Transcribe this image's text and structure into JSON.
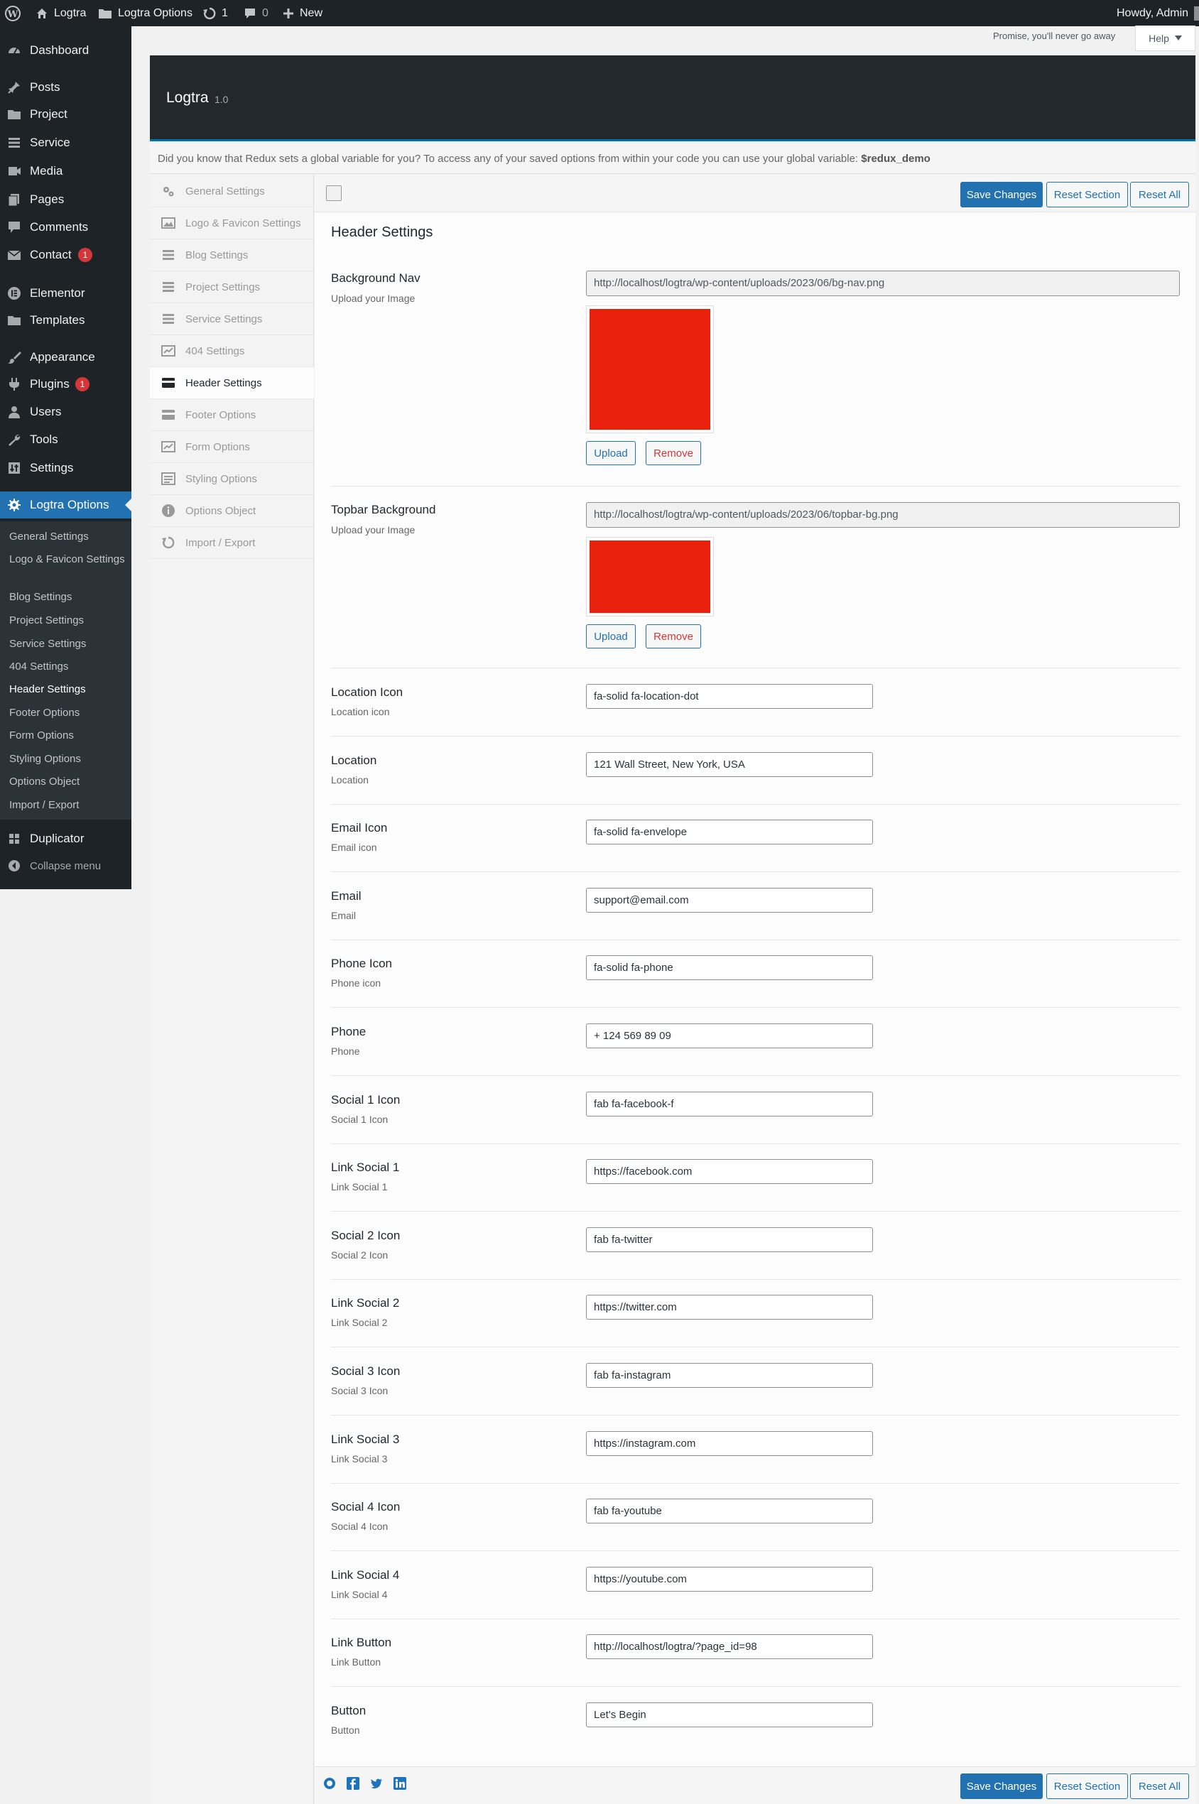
{
  "colors": {
    "admin_dark": "#1d2327",
    "accent": "#2271b1",
    "preview_red": "#e8200c",
    "badge_red": "#d63638"
  },
  "adminbar": {
    "site": "Logtra",
    "options": "Logtra Options",
    "updates": "1",
    "comments": "0",
    "new": "New",
    "howdy": "Howdy, Admin"
  },
  "sidebar": {
    "items": [
      {
        "label": "Dashboard",
        "icon": "dashboard-icon"
      },
      {
        "label": "Posts",
        "icon": "pin-icon"
      },
      {
        "label": "Project",
        "icon": "folder-icon"
      },
      {
        "label": "Service",
        "icon": "list-icon"
      },
      {
        "label": "Media",
        "icon": "media-icon"
      },
      {
        "label": "Pages",
        "icon": "pages-icon"
      },
      {
        "label": "Comments",
        "icon": "comment-icon"
      },
      {
        "label": "Contact",
        "icon": "mail-icon",
        "badge": "1"
      },
      {
        "label": "Elementor",
        "icon": "elementor-icon"
      },
      {
        "label": "Templates",
        "icon": "folder-icon"
      },
      {
        "label": "Appearance",
        "icon": "brush-icon"
      },
      {
        "label": "Plugins",
        "icon": "plug-icon",
        "badge": "1"
      },
      {
        "label": "Users",
        "icon": "user-icon"
      },
      {
        "label": "Tools",
        "icon": "wrench-icon"
      },
      {
        "label": "Settings",
        "icon": "settings-icon"
      },
      {
        "label": "Logtra Options",
        "icon": "gear-icon"
      },
      {
        "label": "Duplicator",
        "icon": "duplicator-icon"
      },
      {
        "label": "Collapse menu",
        "icon": "collapse-icon"
      }
    ],
    "submenu": [
      "General Settings",
      "Logo & Favicon Settings",
      "Blog Settings",
      "Project Settings",
      "Service Settings",
      "404 Settings",
      "Header Settings",
      "Footer Options",
      "Form Options",
      "Styling Options",
      "Options Object",
      "Import / Export"
    ]
  },
  "topright": {
    "promise": "Promise, you'll never go away",
    "help": "Help"
  },
  "redux": {
    "title": "Logtra",
    "version": "1.0",
    "notice": "Did you know that Redux sets a global variable for you? To access any of your saved options from within your code you can use your global variable:",
    "notice_var": "$redux_demo",
    "sections": [
      "General Settings",
      "Logo & Favicon Settings",
      "Blog Settings",
      "Project Settings",
      "Service Settings",
      "404 Settings",
      "Header Settings",
      "Footer Options",
      "Form Options",
      "Styling Options",
      "Options Object",
      "Import / Export"
    ],
    "buttons": {
      "save": "Save Changes",
      "reset_section": "Reset Section",
      "reset_all": "Reset All"
    }
  },
  "section_title": "Header Settings",
  "media_fields": [
    {
      "title": "Background Nav",
      "subtitle": "Upload your Image",
      "url": "http://localhost/logtra/wp-content/uploads/2023/06/bg-nav.png",
      "upload": "Upload",
      "remove": "Remove"
    },
    {
      "title": "Topbar Background",
      "subtitle": "Upload your Image",
      "url": "http://localhost/logtra/wp-content/uploads/2023/06/topbar-bg.png",
      "upload": "Upload",
      "remove": "Remove"
    }
  ],
  "fields": [
    {
      "title": "Location Icon",
      "subtitle": "Location icon",
      "value": "fa-solid fa-location-dot"
    },
    {
      "title": "Location",
      "subtitle": "Location",
      "value": "121 Wall Street, New York, USA"
    },
    {
      "title": "Email Icon",
      "subtitle": "Email icon",
      "value": "fa-solid fa-envelope"
    },
    {
      "title": "Email",
      "subtitle": "Email",
      "value": "support@email.com"
    },
    {
      "title": "Phone Icon",
      "subtitle": "Phone icon",
      "value": "fa-solid fa-phone"
    },
    {
      "title": "Phone",
      "subtitle": "Phone",
      "value": "+ 124 569 89 09"
    },
    {
      "title": "Social 1 Icon",
      "subtitle": "Social 1 Icon",
      "value": "fab fa-facebook-f"
    },
    {
      "title": "Link Social 1",
      "subtitle": "Link Social 1",
      "value": "https://facebook.com"
    },
    {
      "title": "Social 2 Icon",
      "subtitle": "Social 2 Icon",
      "value": "fab fa-twitter"
    },
    {
      "title": "Link Social 2",
      "subtitle": "Link Social 2",
      "value": "https://twitter.com"
    },
    {
      "title": "Social 3 Icon",
      "subtitle": "Social 3 Icon",
      "value": "fab fa-instagram"
    },
    {
      "title": "Link Social 3",
      "subtitle": "Link Social 3",
      "value": "https://instagram.com"
    },
    {
      "title": "Social 4 Icon",
      "subtitle": "Social 4 Icon",
      "value": "fab fa-youtube"
    },
    {
      "title": "Link Social 4",
      "subtitle": "Link Social 4",
      "value": "https://youtube.com"
    },
    {
      "title": "Link Button",
      "subtitle": "Link Button",
      "value": "http://localhost/logtra/?page_id=98"
    },
    {
      "title": "Button",
      "subtitle": "Button",
      "value": "Let's Begin"
    }
  ],
  "footer_social_icons": [
    "redux-icon",
    "facebook-icon",
    "twitter-icon",
    "linkedin-icon"
  ]
}
